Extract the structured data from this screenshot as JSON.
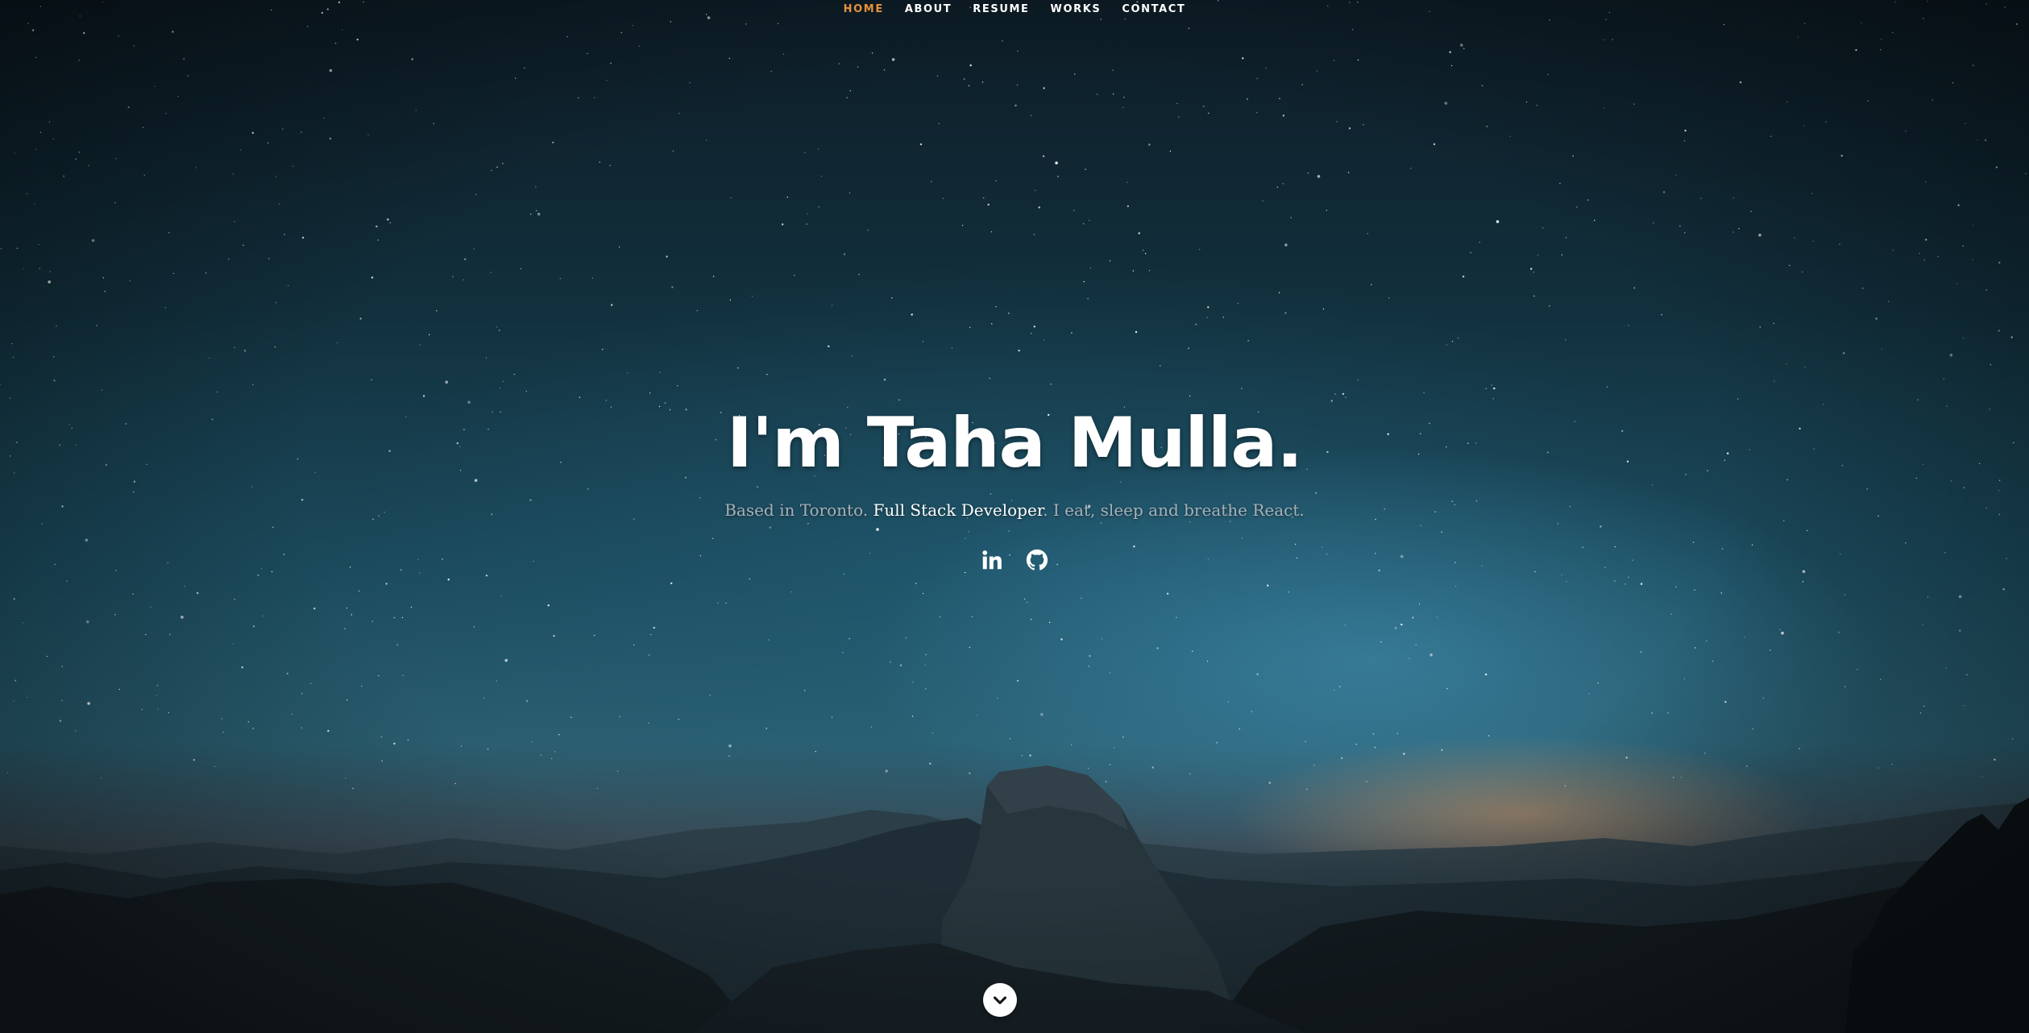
{
  "nav": {
    "items": [
      {
        "label": "HOME",
        "active": true
      },
      {
        "label": "ABOUT",
        "active": false
      },
      {
        "label": "RESUME",
        "active": false
      },
      {
        "label": "WORKS",
        "active": false
      },
      {
        "label": "CONTACT",
        "active": false
      }
    ],
    "active_color": "#e8913a"
  },
  "banner": {
    "headline": "I'm Taha Mulla.",
    "tagline_prefix": "Based in Toronto. ",
    "tagline_highlight": "Full Stack Developer",
    "tagline_suffix": ". I eat, sleep and breathe React."
  },
  "social": [
    {
      "icon": "linkedin-icon"
    },
    {
      "icon": "github-icon"
    }
  ],
  "scroll_down": {
    "icon": "chevron-down-icon"
  }
}
